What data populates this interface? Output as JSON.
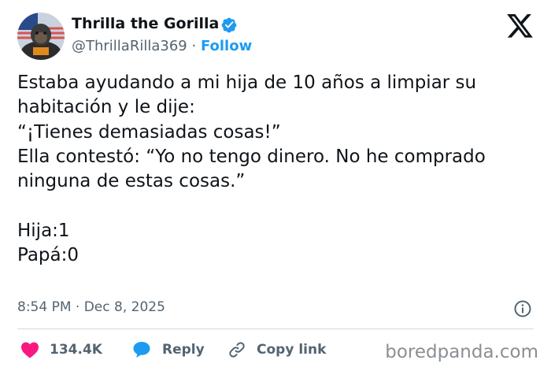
{
  "author": {
    "display_name": "Thrilla the Gorilla",
    "handle": "@ThrillaRilla369",
    "separator": "·",
    "follow_label": "Follow",
    "verified_icon": "verified-badge-icon",
    "avatar_icon": "gorilla-avatar"
  },
  "tweet": {
    "lines": [
      "Estaba ayudando a mi hija de 10 años a limpiar su",
      "habitación y le dije:",
      "“¡Tienes demasiadas cosas!”",
      "Ella contestó: “Yo no tengo dinero. No he comprado",
      "ninguna de estas cosas.”",
      "",
      "Hija:1",
      "Papá:0"
    ],
    "timestamp": "8:54 PM · Dec 8, 2025"
  },
  "actions": {
    "like_count": "134.4K",
    "reply_label": "Reply",
    "copy_link_label": "Copy link"
  },
  "watermark": "boredpanda.com",
  "colors": {
    "accent": "#1d9bf0",
    "like": "#f91880",
    "secondary_text": "#536471",
    "primary_text": "#0f1419"
  }
}
